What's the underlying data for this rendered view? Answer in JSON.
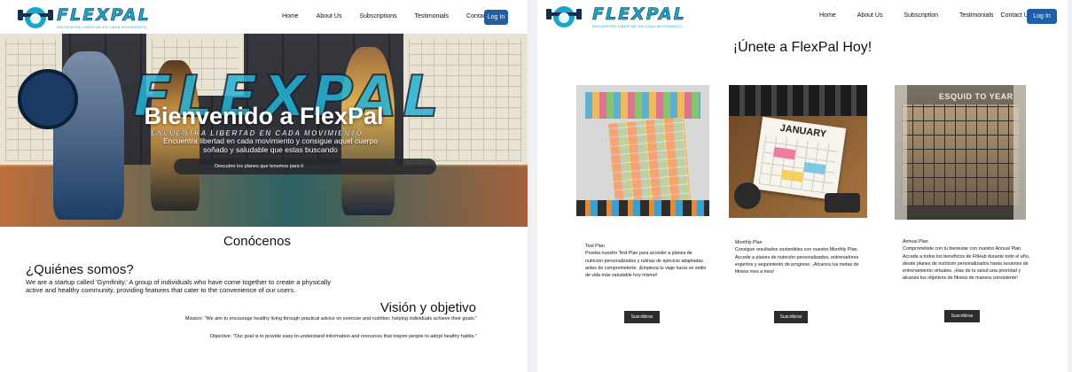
{
  "left_page": {
    "logo": {
      "text": "FLEXPAL",
      "tagline": "ENCUENTRA LIBERTAD EN CADA MOVIMIENTO"
    },
    "nav": {
      "items": [
        "Home",
        "About Us",
        "Subscriptions",
        "Testimonials",
        "Contact us"
      ],
      "login": "Log In"
    },
    "hero": {
      "brand_art": "FLEXPAL",
      "brand_tagline": "ENCUENTRA LIBERTAD EN CADA MOVIMIENTO",
      "title": "Bienvenido a FlexPal",
      "subtitle": "Encuentra libertad en cada movimiento y consigue aquel cuerpo soñado y saludable que estas buscando",
      "button": "Descubre los planes que tenemos para ti"
    },
    "about": {
      "heading": "Conócenos",
      "who_title": "¿Quiénes somos?",
      "who_text": "We are a startup called 'Gymfinity.' A group of individuals who have come together to create a physically active and healthy community, providing features that cater to the convenience of our users.",
      "vision_title": "Visión y objetivo",
      "mission": "Mission: \"We aim to encourage healthy living through practical advice on exercise and nutrition, helping individuals achieve their goals.\"",
      "objective": "Objective: \"Our goal is to provide easy-to-understand information and resources that inspire people to adopt healthy habits.\""
    }
  },
  "right_page": {
    "logo": {
      "text": "FLEXPAL",
      "tagline": "ENCUENTRA LIBERTAD EN CADA MOVIMIENTO"
    },
    "nav": {
      "items": [
        "Home",
        "About Us",
        "Subscription",
        "Testimonials",
        "Contact Us"
      ],
      "login": "Log In"
    },
    "heading": "¡Únete a FlexPal Hoy!",
    "plans": [
      {
        "title": "Test Plan",
        "description": "Prueba nuestro Test Plan para acceder a planes de nutrición personalizados y rutinas de ejercicio adaptadas antes de comprometerte. ¡Empieza tu viaje hacia un estilo de vida más saludable hoy mismo!",
        "button": "Suscribirse"
      },
      {
        "title": "Monthly Plan",
        "description": "Consigue resultados sostenibles con nuestro Monthly Plan. Accede a planes de nutrición personalizados, entrenadores expertos y seguimiento de progreso. ¡Alcanza tus metas de fitness mes a mes!",
        "image_text": "JANUARY",
        "button": "Suscribirse"
      },
      {
        "title": "Annual Plan",
        "description": "Comprométete con tu bienestar con nuestro Annual Plan. Accede a todos los beneficios de FitHub durante todo el año, desde planes de nutrición personalizados hasta sesiones de entrenamiento virtuales. ¡Haz de tu salud una prioridad y alcanza tus objetivos de fitness de manera consistente!",
        "image_text": "ESQUID TO YEAR",
        "button": "Suscribirse"
      }
    ]
  },
  "colors": {
    "accent": "#1f5fa7",
    "brand": "#1aa6c8",
    "dark_button": "#2c2c2c"
  }
}
